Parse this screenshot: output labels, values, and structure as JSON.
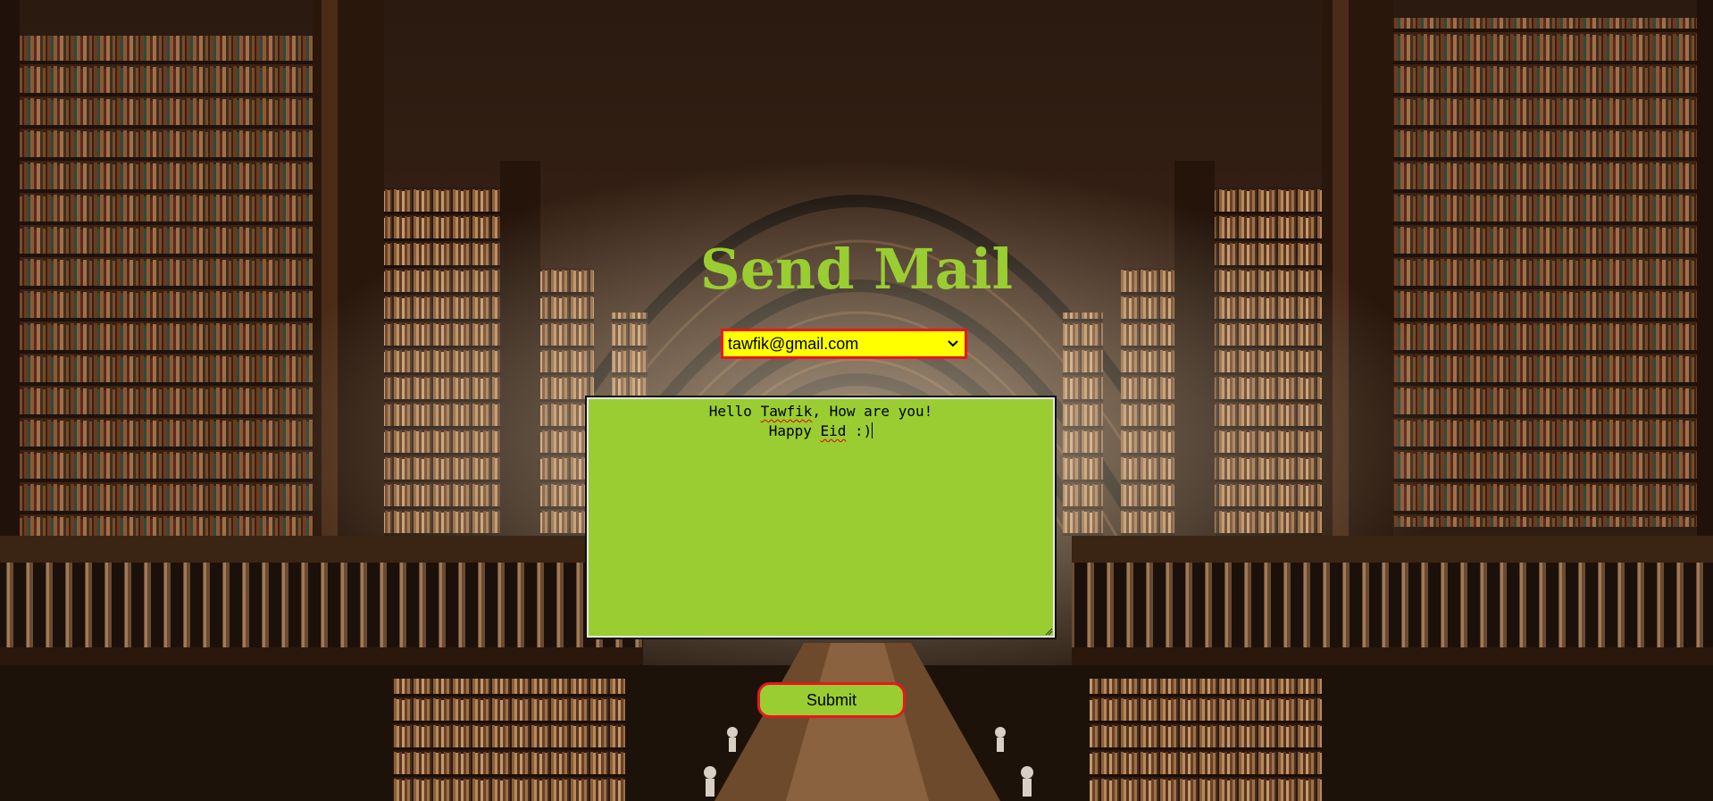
{
  "page": {
    "title": "Send Mail"
  },
  "form": {
    "recipient": {
      "selected": "tawfik@gmail.com"
    },
    "message": {
      "line1_a": "Hello ",
      "line1_spell": "Tawfik",
      "line1_b": ", How are you!",
      "line2_a": "Happy ",
      "line2_spell": "Eid",
      "line2_b": " :)"
    },
    "submit_label": "Submit"
  },
  "colors": {
    "accent": "#9acd32",
    "border_red": "#e8171d",
    "select_bg": "#ffff00"
  },
  "icons": {
    "select_arrow": "chevron-down-icon",
    "textarea_resize": "resize-grip-icon"
  }
}
